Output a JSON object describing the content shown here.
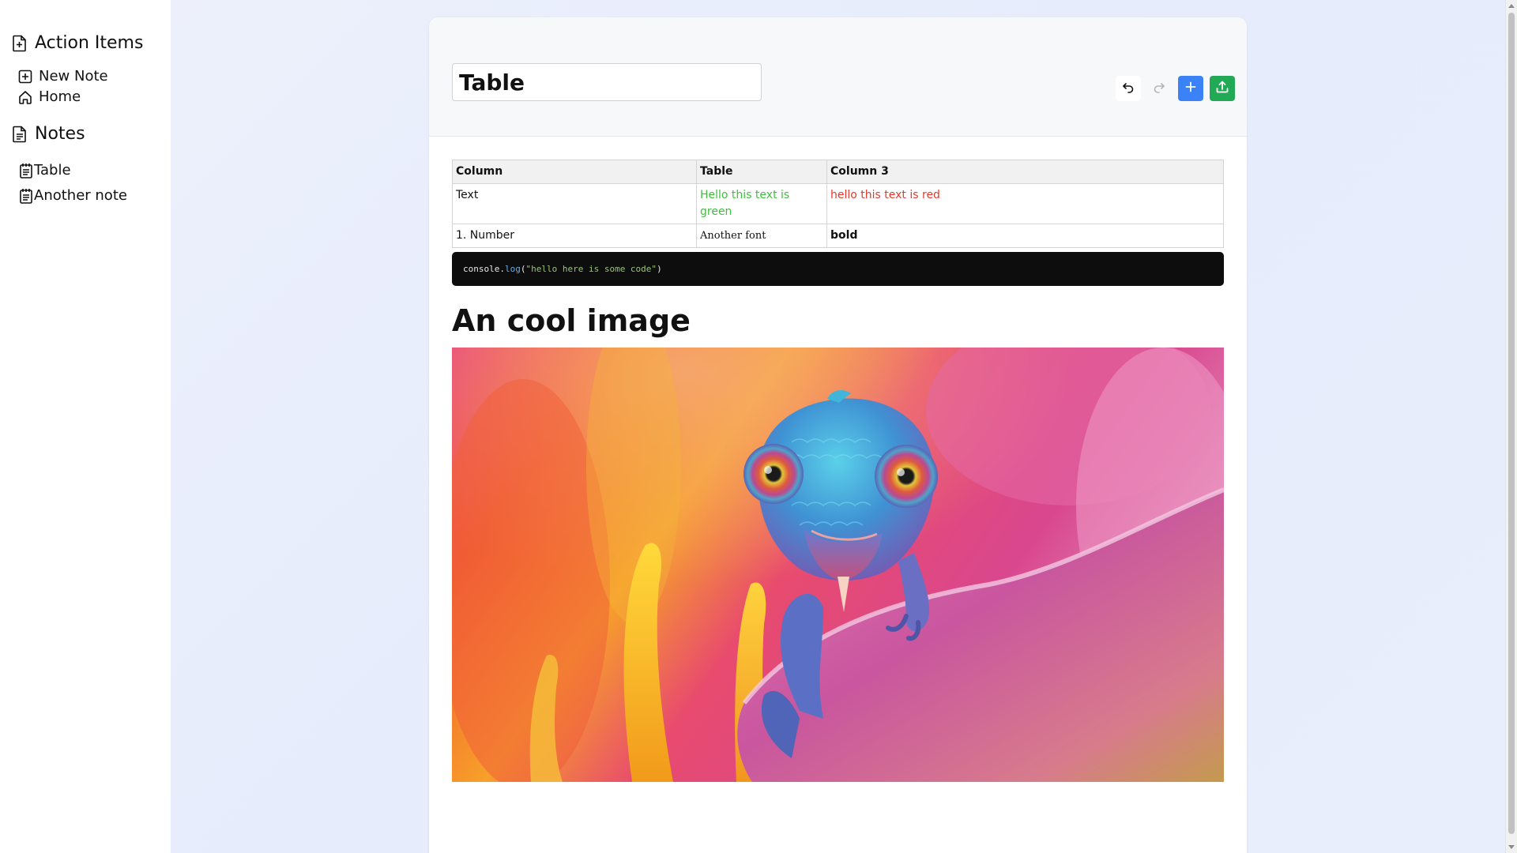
{
  "sidebar": {
    "action_items": {
      "heading": "Action Items",
      "icon": "file-plus-icon",
      "items": [
        {
          "label": "New Note",
          "icon": "square-plus-icon"
        },
        {
          "label": "Home",
          "icon": "home-icon"
        }
      ]
    },
    "notes": {
      "heading": "Notes",
      "icon": "file-text-icon",
      "items": [
        {
          "label": "Table",
          "icon": "notepad-icon"
        },
        {
          "label": "Another note",
          "icon": "notepad-icon"
        }
      ]
    }
  },
  "editor": {
    "title_value": "Table",
    "toolbar": {
      "undo_icon": "undo-icon",
      "redo_icon": "redo-icon",
      "add_icon": "plus-icon",
      "export_icon": "upload-icon",
      "add_color": "#3b82f6",
      "export_color": "#22a955"
    },
    "table": {
      "headers": [
        "Column",
        "Table",
        "Column 3"
      ],
      "rows": [
        [
          "Text",
          "Hello this text is green",
          "hello this text is red"
        ],
        [
          "1. Number",
          "Another font",
          "bold"
        ]
      ],
      "green_color": "#3fbf3f",
      "red_color": "#e23b2e"
    },
    "code": {
      "object": "console",
      "fn": "log",
      "string": "\"hello here is some code\""
    },
    "heading": "An cool image",
    "image_subject": "chameleon-on-flower-petal"
  }
}
